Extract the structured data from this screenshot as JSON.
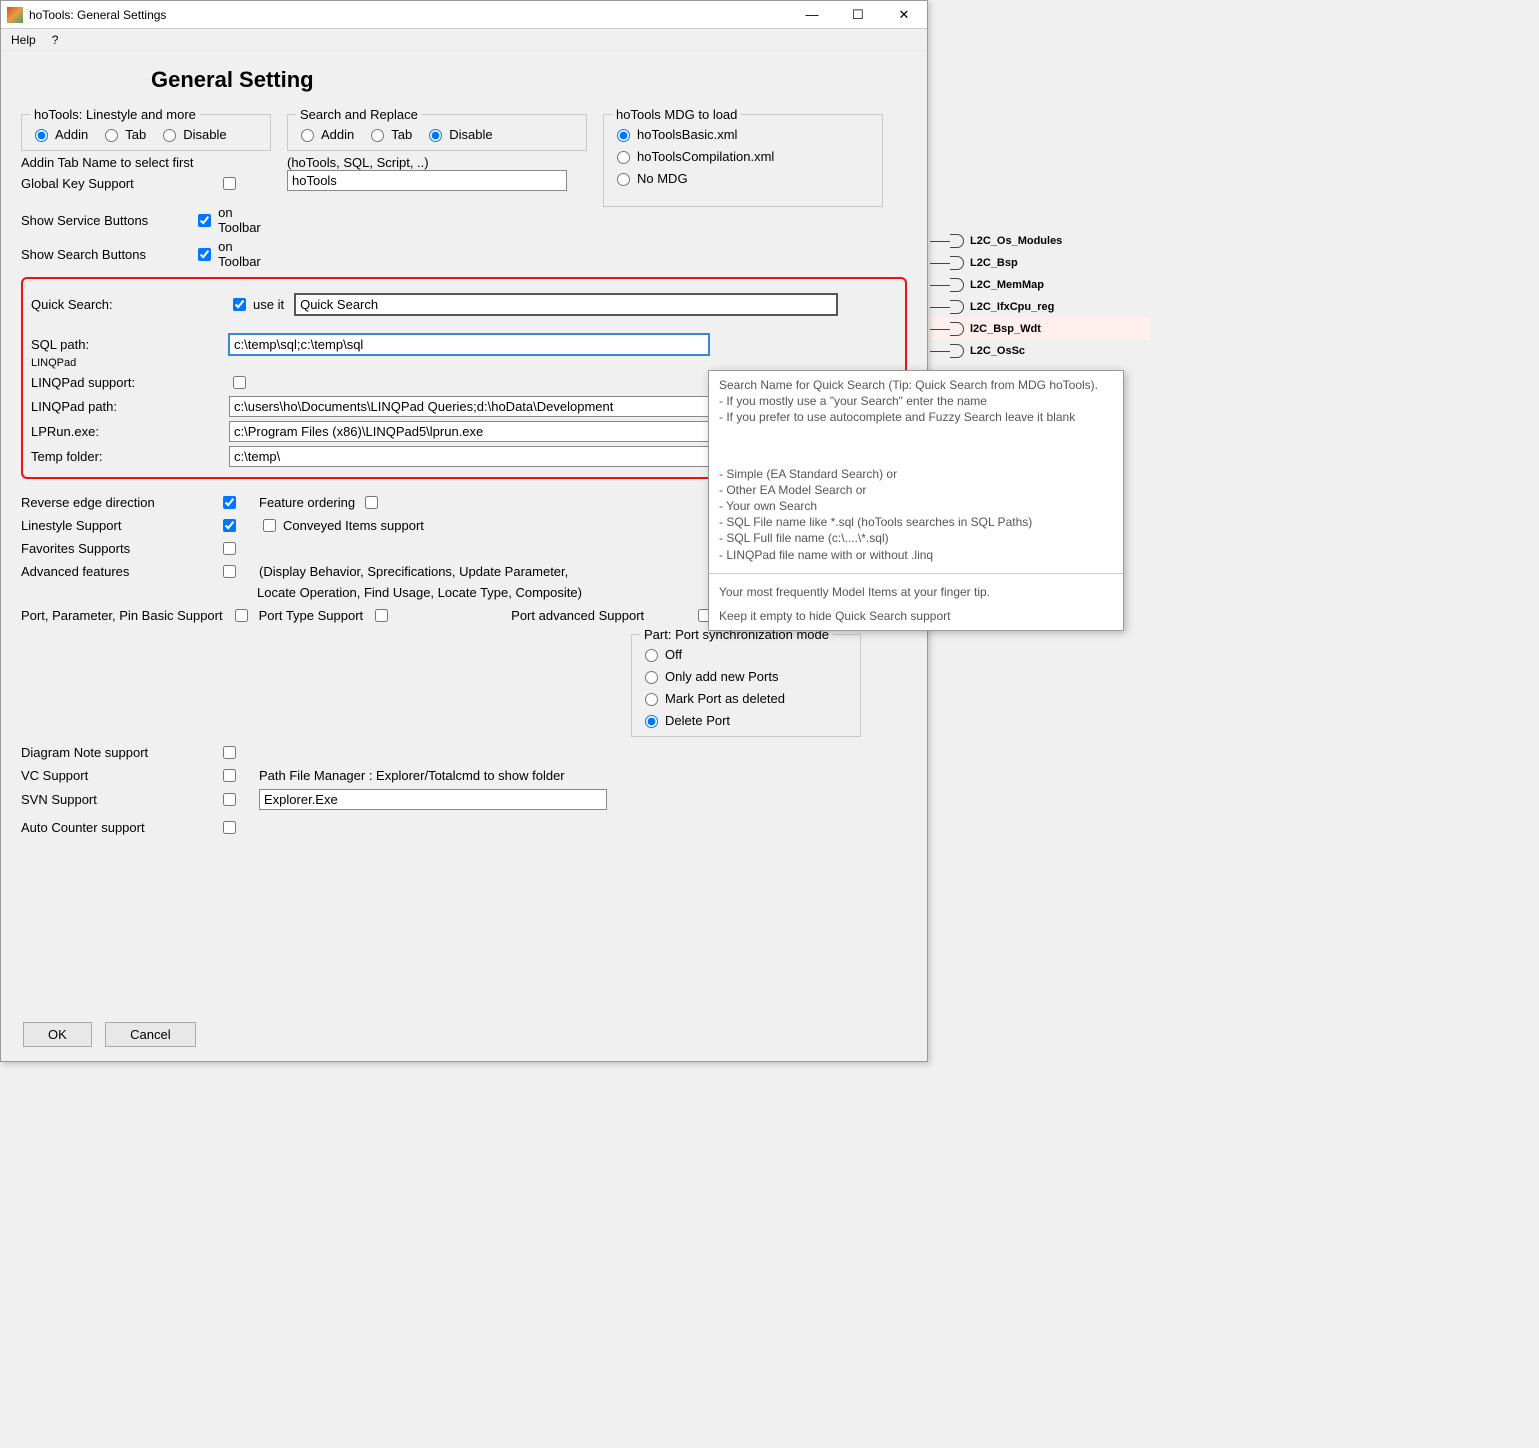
{
  "window": {
    "title": "hoTools: General Settings",
    "menu": {
      "help": "Help",
      "question": "?"
    },
    "controls": {
      "min": "—",
      "max": "☐",
      "close": "✕"
    }
  },
  "page_title": "General Setting",
  "linestyle_group": {
    "legend": "hoTools: Linestyle and more",
    "addin": "Addin",
    "tab": "Tab",
    "disable": "Disable"
  },
  "search_replace_group": {
    "legend": "Search and Replace",
    "addin": "Addin",
    "tab": "Tab",
    "disable": "Disable",
    "hint": "(hoTools, SQL, Script, ..)",
    "value": "hoTools"
  },
  "mdg_group": {
    "legend": "hoTools MDG to load",
    "basic": "hoToolsBasic.xml",
    "compilation": "hoToolsCompilation.xml",
    "none": "No MDG"
  },
  "addin_tab_name": "Addin Tab Name to select first",
  "global_key": "Global Key Support",
  "show_service": "Show Service Buttons",
  "show_search": "Show Search Buttons",
  "on_toolbar": "on Toolbar",
  "quick_search": {
    "label": "Quick  Search:",
    "useit": "use it",
    "value": "Quick Search"
  },
  "sql_path": {
    "label": "SQL path:",
    "value": "c:\\temp\\sql;c:\\temp\\sql"
  },
  "linqpad_tiny": "LINQPad",
  "linqpad_support": "LINQPad support:",
  "linqpad_path": {
    "label": "LINQPad path:",
    "value": "c:\\users\\ho\\Documents\\LINQPad Queries;d:\\hoData\\Development"
  },
  "lprun": {
    "label": "LPRun.exe:",
    "value": "c:\\Program Files (x86)\\LINQPad5\\lprun.exe"
  },
  "temp_folder": {
    "label": "Temp folder:",
    "value": "c:\\temp\\"
  },
  "reverse_edge": "Reverse edge direction",
  "linestyle_support": "Linestyle Support",
  "favorites_support": "Favorites Supports",
  "advanced_features": "Advanced features",
  "feature_ordering": "Feature ordering",
  "conveyed_items": "Conveyed Items support",
  "advanced_desc1": "(Display Behavior, Sprecifications, Update Parameter,",
  "advanced_desc2": "Locate Operation, Find Usage, Locate Type, Composite)",
  "port_basic": "Port, Parameter, Pin Basic Support",
  "port_type": "Port Type Support",
  "port_advanced": "Port advanced Support",
  "port_sync_group": {
    "legend": "Part: Port synchronization mode",
    "off": "Off",
    "add": "Only add new Ports",
    "mark": "Mark Port as deleted",
    "delete": "Delete Port"
  },
  "diagram_note": "Diagram Note support",
  "vc_support": "VC Support",
  "svn_support": "SVN Support",
  "auto_counter": "Auto Counter support",
  "path_file_mgr_label": "Path File Manager : Explorer/Totalcmd  to show folder",
  "path_file_mgr_value": "Explorer.Exe",
  "buttons": {
    "ok": "OK",
    "cancel": "Cancel"
  },
  "tooltip": {
    "l1": "Search  Name for Quick Search (Tip: Quick Search from MDG hoTools).",
    "l2": "- If you mostly use a \"your Search\" enter the name",
    "l3": "- If you prefer to use autocomplete and Fuzzy Search leave it blank",
    "l4": "- Simple (EA Standard Search)  or",
    "l5": "- Other EA Model Search or",
    "l6": "- Your own Search",
    "l7": "- SQL File name like *.sql (hoTools searches in SQL Paths)",
    "l8": "- SQL Full file name (c:\\....\\*.sql)",
    "l9": "- LINQPad file name with or without .linq",
    "l10": "Your most frequently Model Items at your finger tip.",
    "l11": "Keep it empty to hide Quick Search support"
  },
  "diagram_items": {
    "i1": "L2C_Os_Modules",
    "i2": "L2C_Bsp",
    "i3": "L2C_MemMap",
    "i4": "L2C_IfxCpu_reg",
    "i5": "l2C_Bsp_Wdt",
    "i6": "L2C_OsSc"
  }
}
